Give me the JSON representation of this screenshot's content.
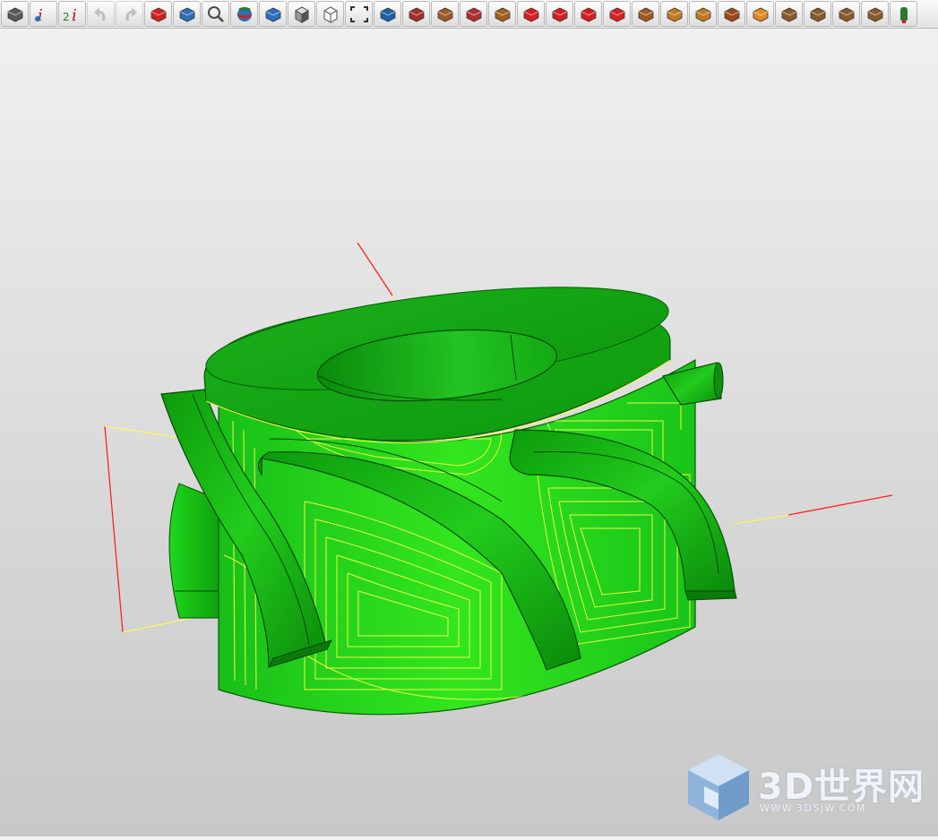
{
  "toolbar": {
    "buttons": [
      {
        "icon": "section-cut-icon",
        "color": "#5a5a5a",
        "enabled": true
      },
      {
        "icon": "info-icon",
        "color": "#b2182b",
        "enabled": true
      },
      {
        "icon": "info-two-entities-icon",
        "color": "#b2182b",
        "enabled": true
      },
      {
        "icon": "undo-icon",
        "color": "#9a9a9a",
        "enabled": false
      },
      {
        "icon": "redo-icon",
        "color": "#9a9a9a",
        "enabled": false
      },
      {
        "icon": "shaded-solid-icon",
        "color": "#d42020",
        "enabled": true
      },
      {
        "icon": "transparent-solid-icon",
        "color": "#2f6fb3",
        "enabled": true
      },
      {
        "icon": "zoom-icon",
        "color": "#4a4a4a",
        "enabled": true
      },
      {
        "icon": "render-sphere-icon",
        "color": "#2c7a2c",
        "enabled": true
      },
      {
        "icon": "view-plane-icon",
        "color": "#2a6fc0",
        "enabled": true
      },
      {
        "icon": "shaded-cube-icon",
        "color": "#555555",
        "enabled": true
      },
      {
        "icon": "wireframe-cube-icon",
        "color": "#666666",
        "enabled": true
      },
      {
        "icon": "fit-all-icon",
        "color": "#333333",
        "enabled": true
      },
      {
        "icon": "surface-sweep-icon",
        "color": "#1f5fa8",
        "enabled": true
      },
      {
        "icon": "motion-animation-icon",
        "color": "#a0302a",
        "enabled": true
      },
      {
        "icon": "measure-curve-icon",
        "color": "#a05a2a",
        "enabled": true
      },
      {
        "icon": "ruled-surface-icon",
        "color": "#b03030",
        "enabled": true
      },
      {
        "icon": "loft-surface-icon",
        "color": "#a0601f",
        "enabled": true
      },
      {
        "icon": "extrude-red-icon",
        "color": "#d42020",
        "enabled": true
      },
      {
        "icon": "extrude-block-icon",
        "color": "#d42020",
        "enabled": true
      },
      {
        "icon": "boolean-red-icon",
        "color": "#d42020",
        "enabled": true
      },
      {
        "icon": "pocket-red-icon",
        "color": "#d42020",
        "enabled": true
      },
      {
        "icon": "sweep-curve-icon",
        "color": "#a05a1f",
        "enabled": true
      },
      {
        "icon": "surface-strip-icon",
        "color": "#c07a20",
        "enabled": true
      },
      {
        "icon": "surface-offset-icon",
        "color": "#c07a20",
        "enabled": true
      },
      {
        "icon": "revolve-goblet-icon",
        "color": "#9a4a1a",
        "enabled": true
      },
      {
        "icon": "flat-surface-icon",
        "color": "#e08a20",
        "enabled": true
      },
      {
        "icon": "bend-surface-icon",
        "color": "#8a5a2a",
        "enabled": true
      },
      {
        "icon": "blend-surface-icon",
        "color": "#8a5a2a",
        "enabled": true
      },
      {
        "icon": "fold-surface-icon",
        "color": "#8a5a2a",
        "enabled": true
      },
      {
        "icon": "curved-surface-icon",
        "color": "#8a5a2a",
        "enabled": true
      },
      {
        "icon": "more-tools-icon",
        "color": "#2a7a2a",
        "enabled": true
      }
    ]
  },
  "viewport": {
    "background_top": "#f2f2f2",
    "background_bottom": "#c8c8c8",
    "model_color": "#1fcf1f",
    "model_dark": "#0b8f0b",
    "toolpath_color": "#ffff44",
    "axis_color": "#ff2020"
  },
  "watermark": {
    "title": "3D世界网",
    "subtitle": "WWW.3DSJW.COM"
  }
}
